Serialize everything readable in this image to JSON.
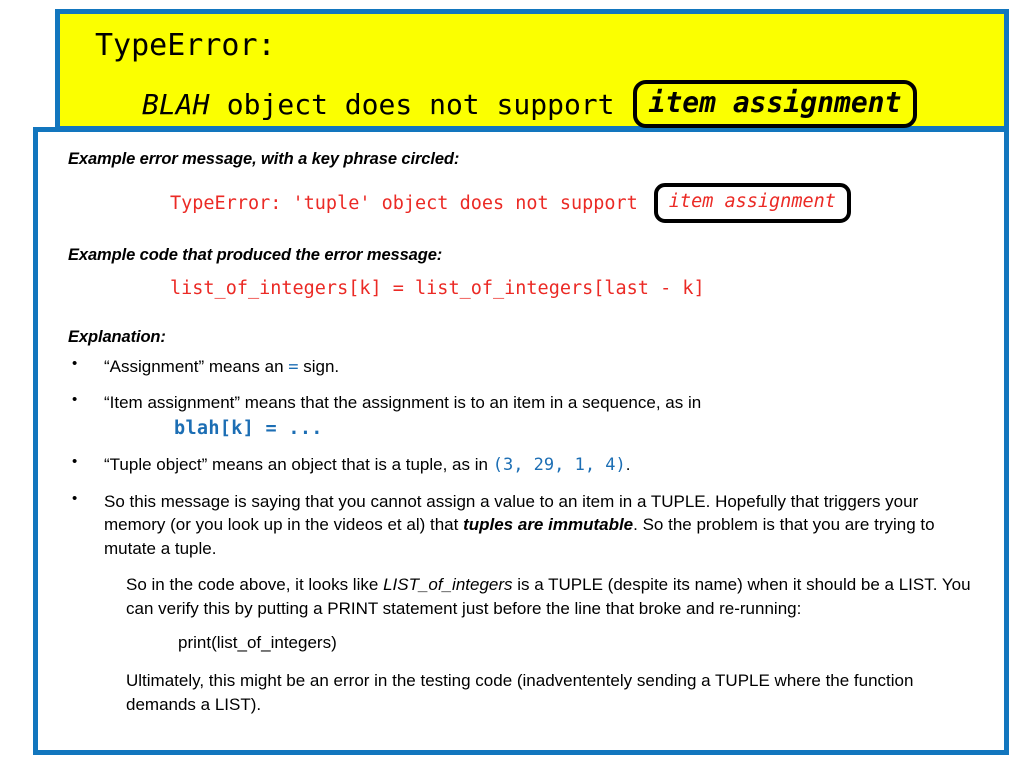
{
  "title_banner": {
    "line1": "TypeError:",
    "line2_emph": "BLAH",
    "line2_rest": "object does not support",
    "line2_boxed": "item assignment",
    "background_color": "#FBFF00",
    "border_color": "#1276BE"
  },
  "body": {
    "border_color": "#1276BE",
    "heading_error": "Example error message, with a key phrase circled:",
    "error_message": "TypeError: 'tuple' object does not support",
    "error_boxed": "item assignment",
    "error_color": "#EB2A25",
    "heading_code": "Example code that produced the error message:",
    "code_line": "list_of_integers[k] = list_of_integers[last - k]",
    "heading_explanation": "Explanation:",
    "accent_blue": "#1C6EB4",
    "bullets": [
      {
        "pre": "“Assignment” means an",
        "code": "=",
        "post": "sign."
      },
      {
        "pre": "“Item assignment” means that the assignment is to an item in a sequence, as in",
        "sub_code": "blah[k] = ..."
      },
      {
        "pre": "“Tuple object” means an object that is a tuple, as in",
        "code": "(3, 29, 1, 4)",
        "post": "."
      },
      {
        "pre": "So this message is saying that you cannot assign a value to an item in a TUPLE.  Hopefully that triggers your memory (or you look up in the videos et al) that",
        "bold_italic": "tuples are immutable",
        "post": ".  So the problem is that you are trying to mutate a tuple."
      }
    ],
    "sub_paragraph_1_pre": "So in the code above, it looks like",
    "sub_paragraph_1_italic": "LIST_of_integers",
    "sub_paragraph_1_post": "is a TUPLE (despite its name) when it should be a LIST.  You can verify this by putting a PRINT statement just before the line that broke and re-running:",
    "print_statement": "print(list_of_integers)",
    "sub_paragraph_2": "Ultimately, this might be an error in the testing code (inadvententely sending a TUPLE where the function demands a LIST)."
  }
}
